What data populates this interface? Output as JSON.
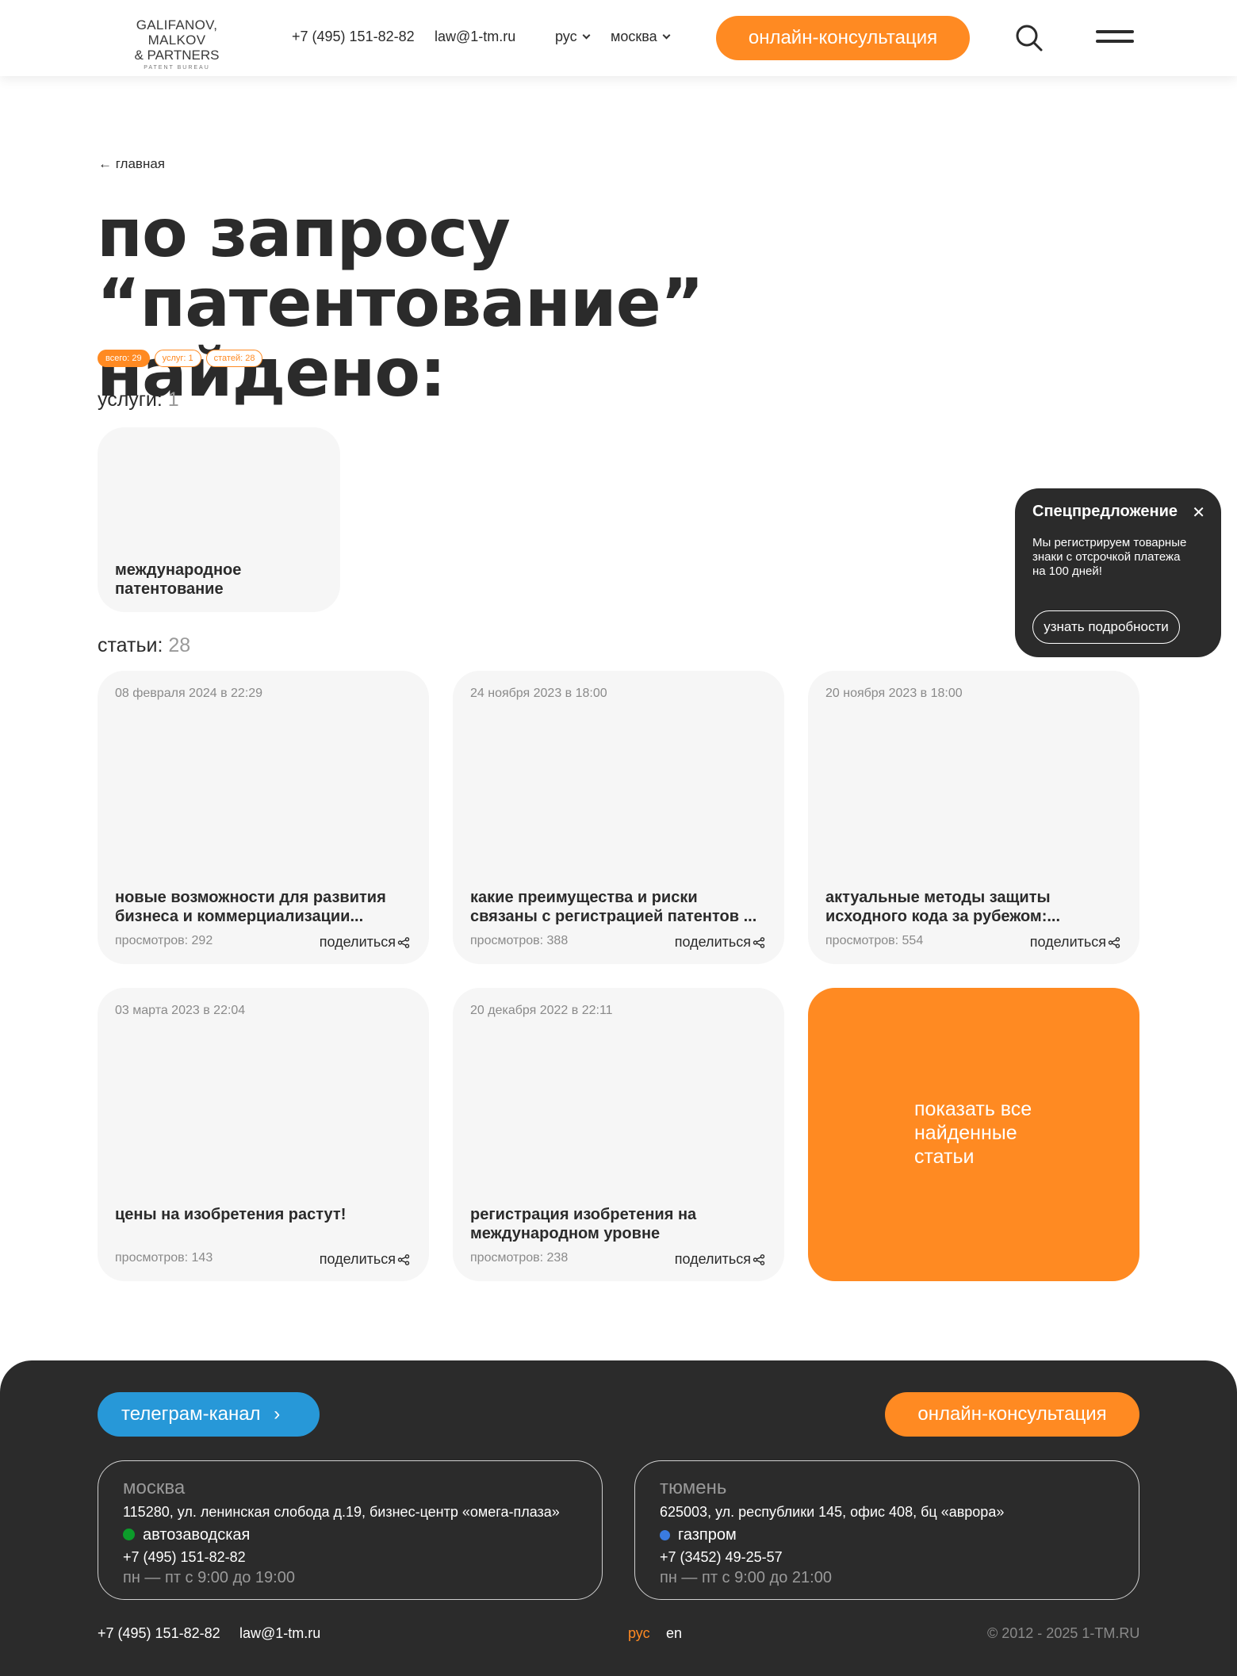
{
  "header": {
    "logo_line1": "GALIFANOV, MALKOV",
    "logo_line2": "& PARTNERS",
    "logo_line3": "PATENT BUREAU",
    "phone": "+7 (495) 151-82-82",
    "email": "law@1-tm.ru",
    "language": "рус",
    "city": "москва",
    "consult_button": "онлайн-консультация"
  },
  "breadcrumb": "← главная",
  "title": "по запросу “патентование” найдено:",
  "chips": [
    {
      "label": "всего: 29",
      "active": true
    },
    {
      "label": "услуг: 1",
      "active": false
    },
    {
      "label": "статей: 28",
      "active": false
    }
  ],
  "services": {
    "heading": "услуги:",
    "count": "1",
    "items": [
      {
        "title_line1": "международное",
        "title_line2": "патентование"
      }
    ]
  },
  "articles": {
    "heading": "статьи:",
    "count": "28",
    "share_label": "поделиться",
    "items": [
      {
        "date": "08 февраля 2024 в 22:29",
        "title_line1": "новые возможности для развития",
        "title_line2": "бизнеса и коммерциализации...",
        "views": "просмотров: 292"
      },
      {
        "date": "24 ноября 2023 в 18:00",
        "title_line1": "какие преимущества и риски",
        "title_line2": "связаны с регистрацией патентов ...",
        "views": "просмотров: 388"
      },
      {
        "date": "20 ноября 2023 в 18:00",
        "title_line1": "актуальные методы защиты",
        "title_line2": "исходного кода за рубежом:...",
        "views": "просмотров: 554"
      },
      {
        "date": "03 марта 2023 в 22:04",
        "title_line1": "цены на изобретения растут!",
        "title_line2": "",
        "views": "просмотров: 143"
      },
      {
        "date": "20 декабря 2022 в 22:11",
        "title_line1": "регистрация изобретения на",
        "title_line2": "международном уровне",
        "views": "просмотров: 238"
      }
    ],
    "show_all_line1": "показать все",
    "show_all_line2": "найденные",
    "show_all_line3": "статьи"
  },
  "popup": {
    "title": "Спецпредложение",
    "close": "✕",
    "text": "Мы регистрируем товарные знаки с отсрочкой платежа на 100 дней!",
    "button": "узнать подробности"
  },
  "footer": {
    "telegram_button": "телеграм-канал",
    "consult_button": "онлайн-консультация",
    "offices": [
      {
        "city": "москва",
        "address": "115280, ул. ленинская слобода д.19, бизнес-центр «омега-плаза»",
        "metro": "автозаводская",
        "phone": "+7 (495) 151-82-82",
        "hours": "пн — пт с 9:00 до 19:00"
      },
      {
        "city": "тюмень",
        "address": "625003, ул. республики 145, офис 408, бц «аврора»",
        "metro": "газпром",
        "phone": "+7 (3452) 49-25-57",
        "hours": "пн — пт с 9:00 до 21:00"
      }
    ],
    "phone": "+7 (495) 151-82-82",
    "email": "law@1-tm.ru",
    "lang_ru": "рус",
    "lang_en": "en",
    "copyright": "© 2012 - 2025 1-TM.RU"
  },
  "colors": {
    "accent": "#ff8a22",
    "dark": "#2b2b2b",
    "telegram": "#2798d8",
    "metro_green": "#0c9c2a"
  }
}
